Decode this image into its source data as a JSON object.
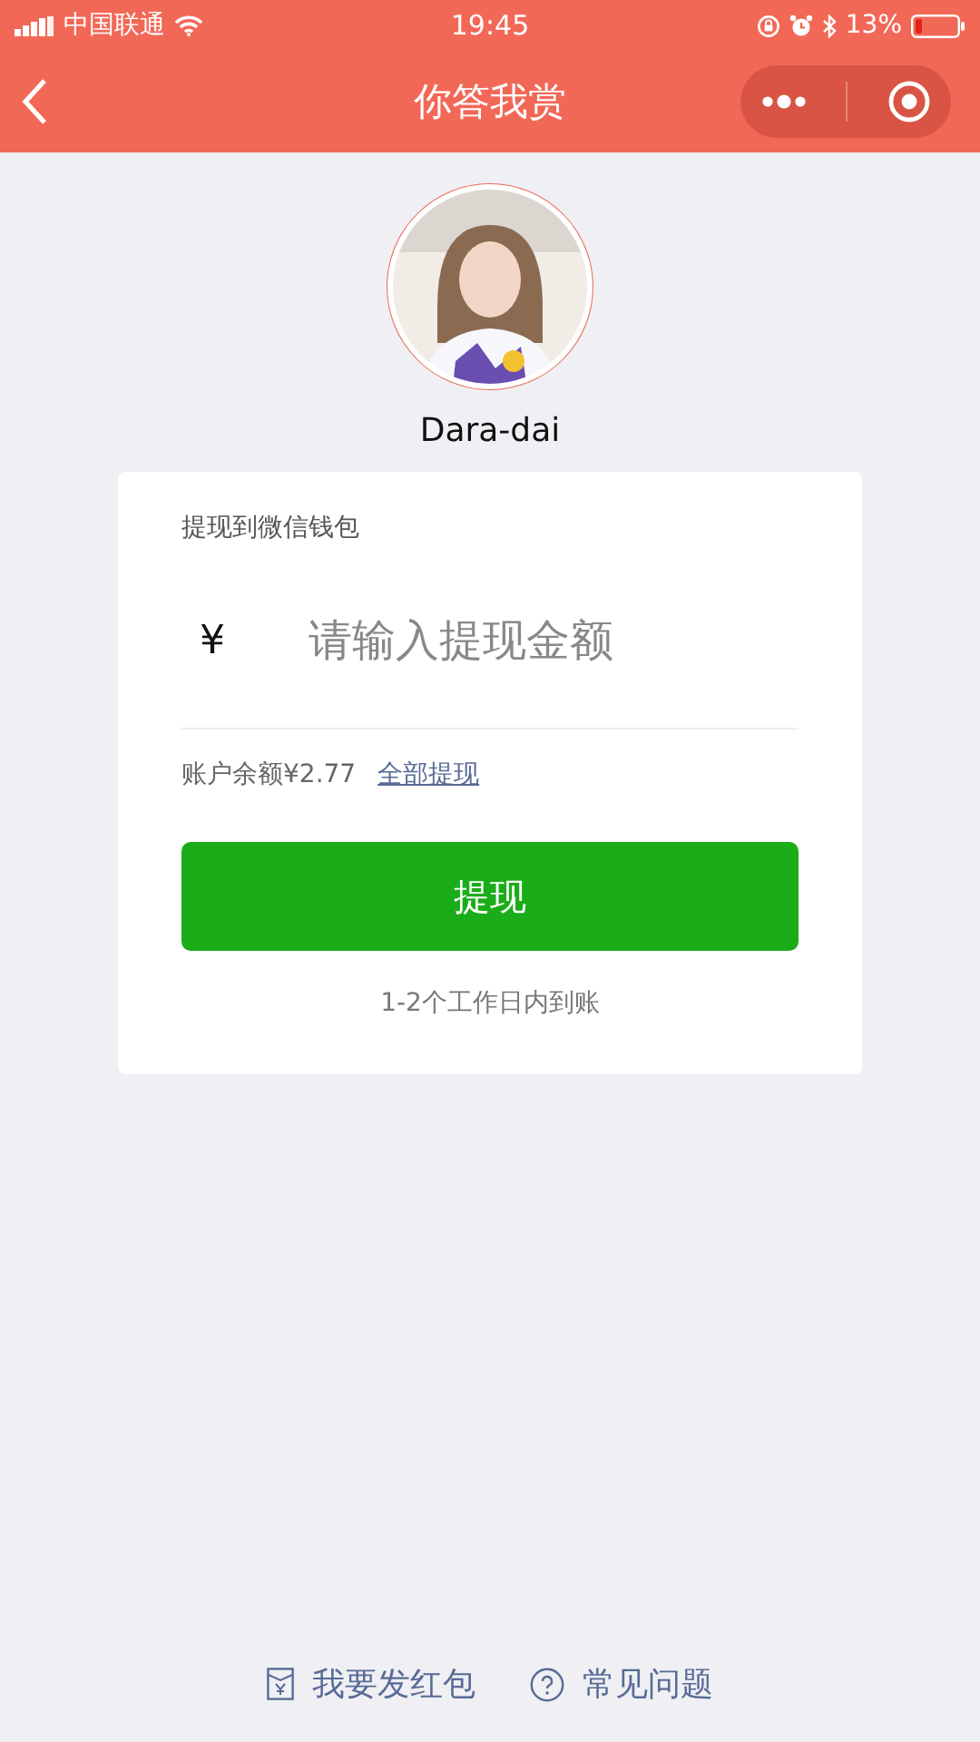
{
  "status_bar": {
    "carrier": "中国联通",
    "time": "19:45",
    "battery": "13%"
  },
  "nav_bar": {
    "title": "你答我赏"
  },
  "profile": {
    "name": "Dara-dai"
  },
  "withdraw_card": {
    "heading": "提现到微信钱包",
    "currency": "¥",
    "amount_placeholder": "请输入提现金额",
    "balance": "账户余额¥2.77",
    "withdraw_all_link": "全部提现",
    "submit_button": "提现",
    "note": "1-2个工作日内到账"
  },
  "footer_links": [
    {
      "kind": "red-packet",
      "label": "我要发红包"
    },
    {
      "kind": "help",
      "label": "常见问题"
    }
  ]
}
